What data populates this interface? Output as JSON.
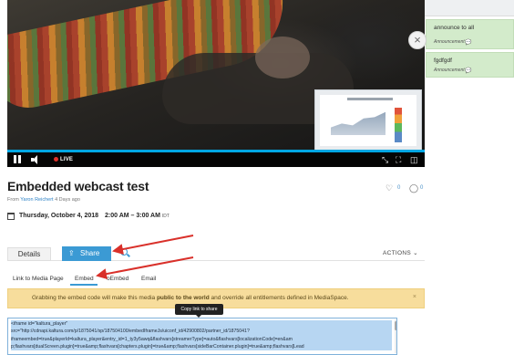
{
  "player": {
    "live_label": "LIVE",
    "progress_fraction": 1.0
  },
  "sidebar": {
    "announcements": [
      {
        "text": "announce to all",
        "type_label": "Announcement"
      },
      {
        "text": "fgdfgdf",
        "type_label": "Announcement"
      }
    ]
  },
  "media": {
    "title": "Embedded webcast test",
    "byline_prefix": "From",
    "author": "Yaron Reichert",
    "age": "4 Days ago",
    "likes": "0",
    "comments": "0",
    "date": "Thursday, October 4, 2018",
    "time_range": "2:00 AM – 3:00 AM",
    "timezone": "IDT"
  },
  "tabs": {
    "details": "Details",
    "share": "Share",
    "actions": "ACTIONS"
  },
  "share_tabs": [
    "Link to Media Page",
    "Embed",
    "oEmbed",
    "Email"
  ],
  "warning": {
    "before": "Grabbing the embed code will make this media ",
    "bold": "public to the world",
    "after": " and override all entitlements defined in MediaSpace.",
    "close": "×"
  },
  "tooltip": "Copy link to share",
  "embed_code_lines": [
    "<iframe id=\"kaltura_player\"",
    "src=\"http://cdnapi.kaltura.com/p/1875041/sp/187504100/embedIframeJs/uiconf_id/42900802/partner_id/1875041?",
    "iframeembed=true&playerId=kaltura_player&entry_id=1_ty3y5awq&flashvars[streamerType]=auto&flashvars[localizationCode]=en&am",
    "p;flashvars[dualScreen.plugin]=true&amp;flashvars[chapters.plugin]=true&amp;flashvars[sideBarContainer.plugin]=true&amp;flashvars[Lead"
  ],
  "colors": {
    "accent": "#3b9ad4",
    "announcement_bg": "#d3ebcb",
    "warning_bg": "#f7dd9c",
    "annotation_arrow": "#d9302a"
  }
}
